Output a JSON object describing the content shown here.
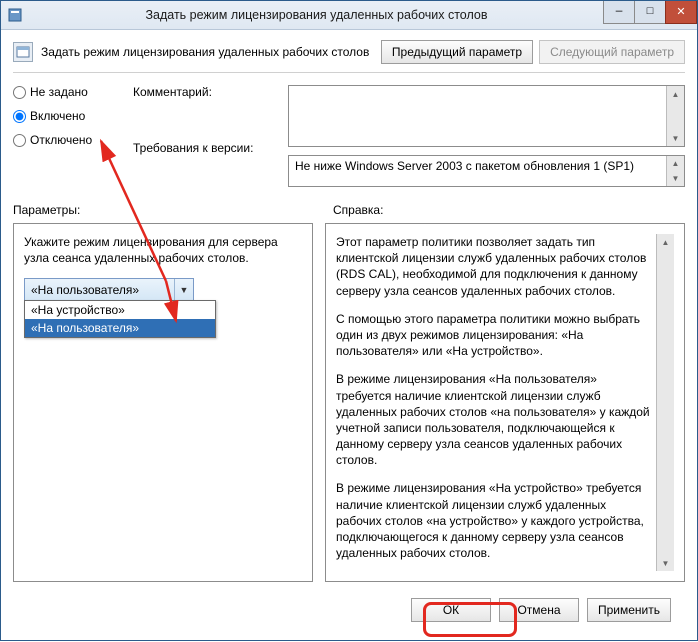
{
  "window": {
    "title": "Задать режим лицензирования удаленных рабочих столов"
  },
  "header": {
    "policy_title": "Задать режим лицензирования удаленных рабочих столов",
    "prev_btn": "Предыдущий параметр",
    "next_btn": "Следующий параметр"
  },
  "radios": {
    "not_configured": "Не задано",
    "enabled": "Включено",
    "disabled": "Отключено",
    "selected": "enabled"
  },
  "labels": {
    "comment": "Комментарий:",
    "requirements": "Требования к версии:",
    "parameters": "Параметры:",
    "help": "Справка:"
  },
  "comment_value": "",
  "requirements_value": "Не ниже Windows Server 2003 с пакетом обновления 1 (SP1)",
  "left_panel": {
    "hint": "Укажите режим лицензирования для сервера узла сеанса удаленных рабочих столов.",
    "combo_selected": "«На пользователя»",
    "combo_option_device": "«На устройство»",
    "combo_option_user": "«На пользователя»"
  },
  "help": {
    "p1": "Этот параметр политики позволяет задать тип клиентской лицензии служб удаленных рабочих столов (RDS CAL), необходимой для подключения к данному серверу узла сеансов удаленных рабочих столов.",
    "p2": "С помощью этого параметра политики можно выбрать один из двух режимов лицензирования: «На пользователя» или «На устройство».",
    "p3": "В режиме лицензирования «На пользователя» требуется наличие клиентской лицензии служб удаленных рабочих столов «на пользователя» у каждой учетной записи пользователя, подключающейся к данному серверу узла сеансов удаленных рабочих столов.",
    "p4": "В режиме лицензирования «На устройство» требуется наличие клиентской лицензии служб удаленных рабочих столов «на устройство» у каждого устройства, подключающегося к данному серверу узла сеансов удаленных рабочих столов."
  },
  "footer": {
    "ok": "ОК",
    "cancel": "Отмена",
    "apply": "Применить"
  },
  "annotation": {
    "arrow_color": "#e2281f"
  }
}
